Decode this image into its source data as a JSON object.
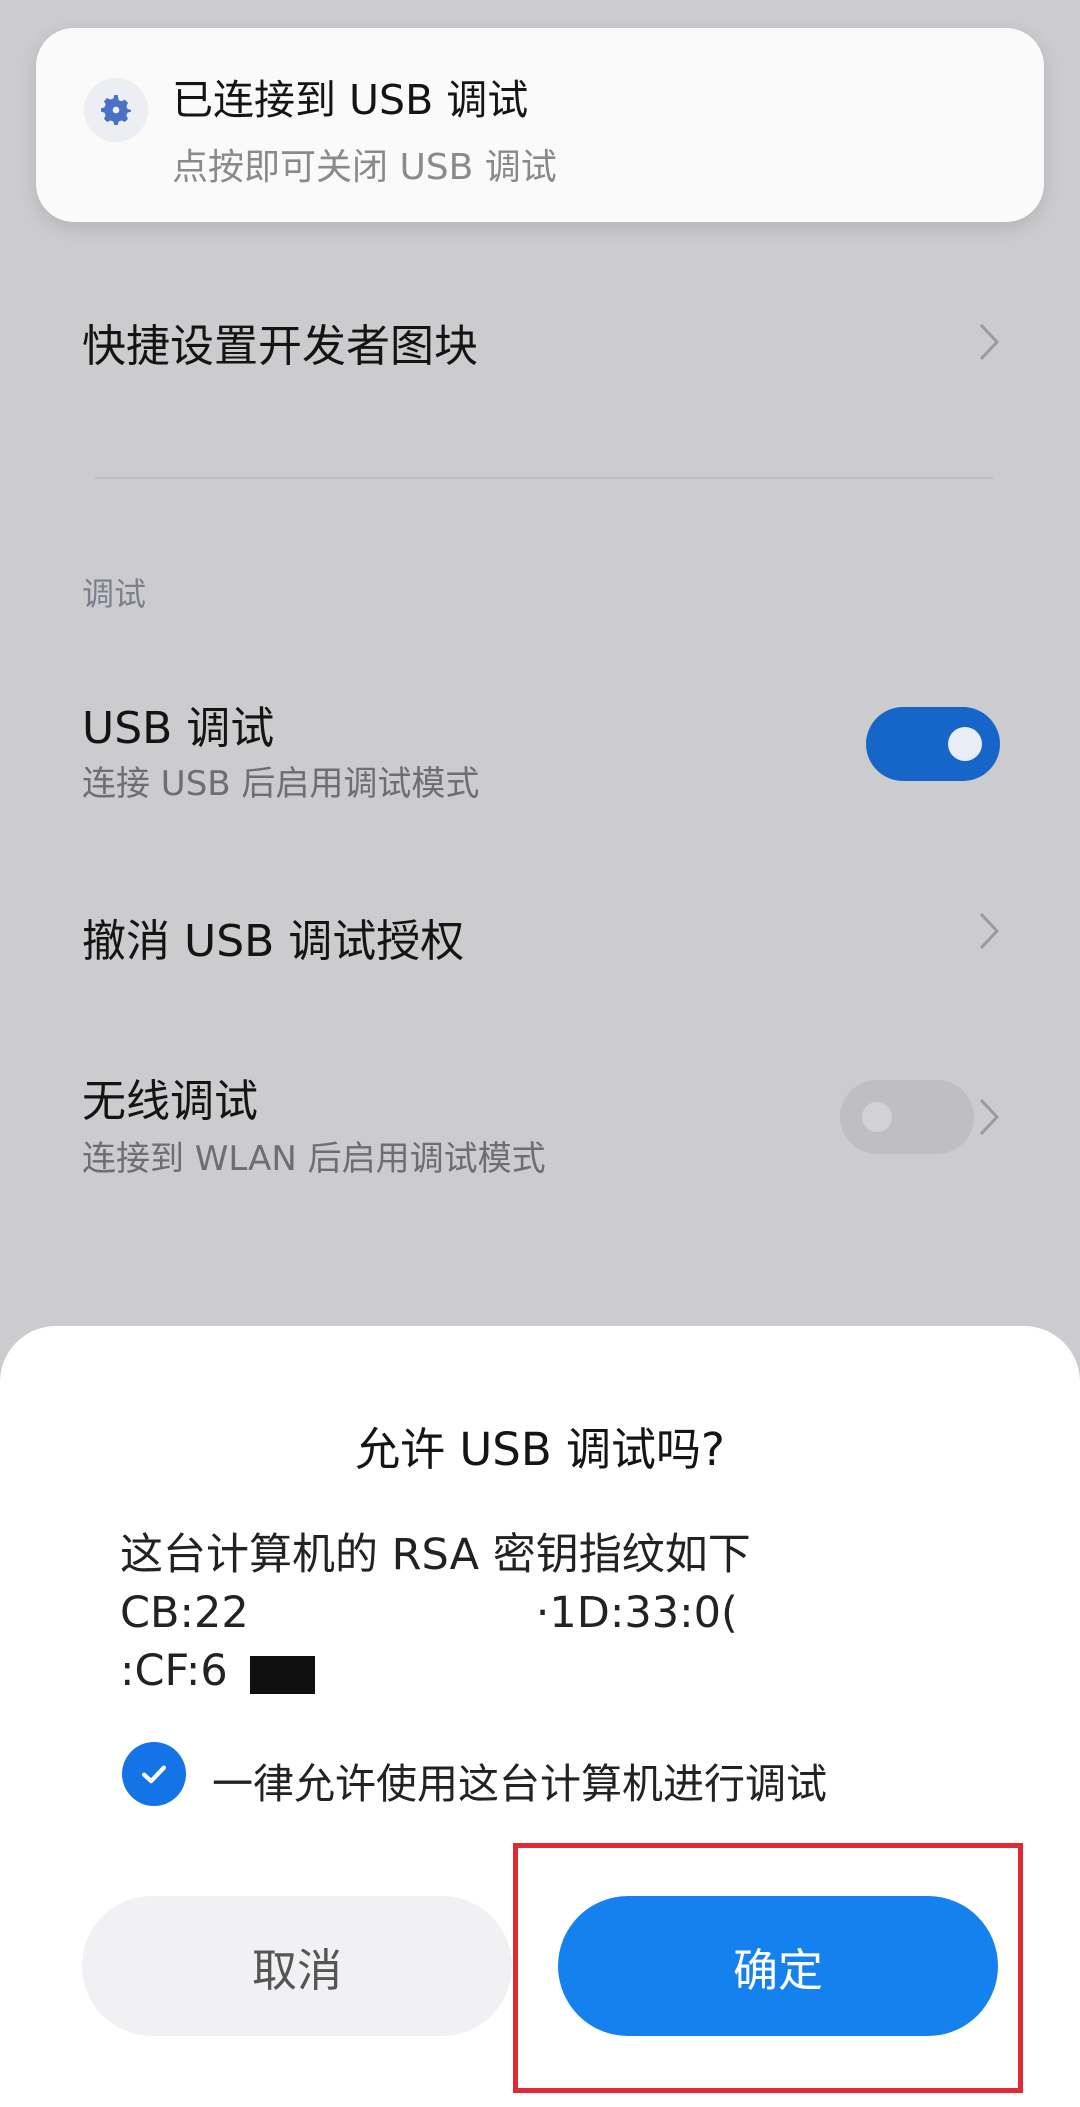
{
  "notification": {
    "icon": "gear-icon",
    "title": "已连接到 USB 调试",
    "subtitle": "点按即可关闭 USB 调试"
  },
  "settings": {
    "quick_tiles_label": "快捷设置开发者图块",
    "section_debug": "调试",
    "usb_debug": {
      "title": "USB 调试",
      "subtitle": "连接 USB 后启用调试模式",
      "enabled": true
    },
    "revoke_usb": {
      "title": "撤消 USB 调试授权"
    },
    "wireless_debug": {
      "title": "无线调试",
      "subtitle": "连接到 WLAN 后启用调试模式",
      "enabled": false
    }
  },
  "dialog": {
    "title": "允许 USB 调试吗?",
    "body_lines": [
      "这台计算机的 RSA 密钥指纹如下",
      "CB:22                     ·1D:33:0(",
      ":CF:6"
    ],
    "always_allow_label": "一律允许使用这台计算机进行调试",
    "always_allow_checked": true,
    "cancel_label": "取消",
    "confirm_label": "确定"
  },
  "colors": {
    "accent": "#1481ef",
    "toggle_on": "#1665c8",
    "highlight": "#e02b33"
  }
}
